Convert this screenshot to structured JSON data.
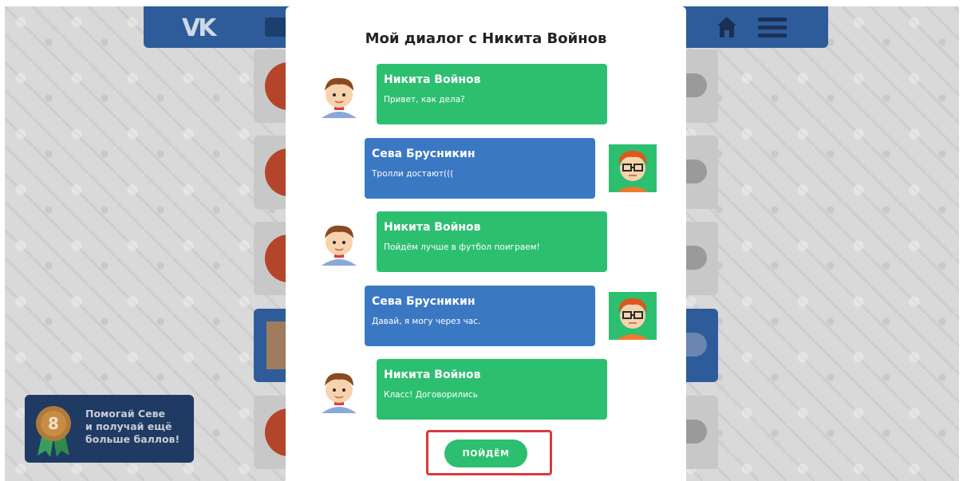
{
  "header": {
    "logo_text": "VK",
    "icons": {
      "home": "home-icon",
      "menu": "menu-icon"
    },
    "color": "#2e5c9a"
  },
  "badge": {
    "number": "8",
    "lines": [
      "Помогай Севе",
      "и получай ещё",
      "больше баллов!"
    ]
  },
  "dialog": {
    "title": "Мой диалог с Никита Войнов",
    "messages": [
      {
        "side": "left",
        "name": "Никита Войнов",
        "text": "Привет, как дела?",
        "color": "#2dbf70",
        "avatar": "boy-avatar-icon"
      },
      {
        "side": "right",
        "name": "Сева Брусникин",
        "text": "Тролли достают(((",
        "color": "#3b78c3",
        "avatar": "redhead-glasses-avatar-icon"
      },
      {
        "side": "left",
        "name": "Никита Войнов",
        "text": "Пойдём лучше в футбол поиграем!",
        "color": "#2dbf70",
        "avatar": "boy-avatar-icon"
      },
      {
        "side": "right",
        "name": "Сева Брусникин",
        "text": "Давай, я могу через час.",
        "color": "#3b78c3",
        "avatar": "redhead-glasses-avatar-icon"
      },
      {
        "side": "left",
        "name": "Никита Войнов",
        "text": "Класс! Договорились",
        "color": "#2dbf70",
        "avatar": "boy-avatar-icon"
      }
    ],
    "button_label": "ПОЙДЁМ",
    "highlight_color": "#d93a3a"
  }
}
